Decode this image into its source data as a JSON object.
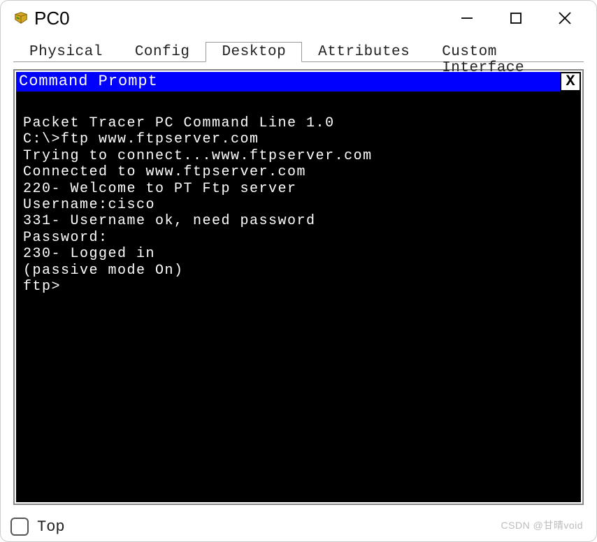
{
  "window": {
    "title": "PC0"
  },
  "tabs": {
    "items": [
      {
        "label": "Physical",
        "active": false
      },
      {
        "label": "Config",
        "active": false
      },
      {
        "label": "Desktop",
        "active": true
      },
      {
        "label": "Attributes",
        "active": false
      },
      {
        "label": "Custom Interface",
        "active": false
      }
    ]
  },
  "command_prompt": {
    "title": "Command Prompt",
    "close_label": "X",
    "lines": [
      "Packet Tracer PC Command Line 1.0",
      "C:\\>ftp www.ftpserver.com",
      "Trying to connect...www.ftpserver.com",
      "Connected to www.ftpserver.com",
      "220- Welcome to PT Ftp server",
      "Username:cisco",
      "331- Username ok, need password",
      "Password:",
      "230- Logged in",
      "(passive mode On)",
      "ftp>"
    ]
  },
  "footer": {
    "top_label": "Top"
  },
  "watermark": "CSDN @甘晴void"
}
